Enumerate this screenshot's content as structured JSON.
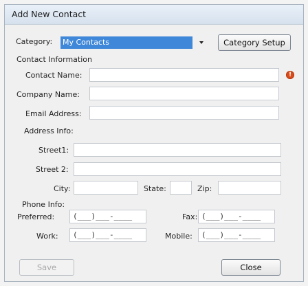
{
  "window": {
    "title": "Add New Contact"
  },
  "category": {
    "label": "Category:",
    "selected": "My Contacts",
    "setup_button": "Category Setup"
  },
  "contact_info": {
    "header": "Contact Information",
    "contact_name_label": "Contact Name:",
    "contact_name_value": "",
    "company_name_label": "Company Name:",
    "company_name_value": "",
    "email_label": "Email Address:",
    "email_value": "",
    "error_icon": "!"
  },
  "address": {
    "header": "Address Info:",
    "street1_label": "Street1:",
    "street1_value": "",
    "street2_label": "Street 2:",
    "street2_value": "",
    "city_label": "City:",
    "city_value": "",
    "state_label": "State:",
    "state_value": "",
    "zip_label": "Zip:",
    "zip_value": ""
  },
  "phone": {
    "header": "Phone Info:",
    "preferred_label": "Preferred:",
    "preferred_mask": "(___)___-____",
    "fax_label": "Fax:",
    "fax_mask": "(___)___-____",
    "work_label": "Work:",
    "work_mask": "(___)___-____",
    "mobile_label": "Mobile:",
    "mobile_mask": "(___)___-____"
  },
  "buttons": {
    "save": "Save",
    "close": "Close"
  }
}
